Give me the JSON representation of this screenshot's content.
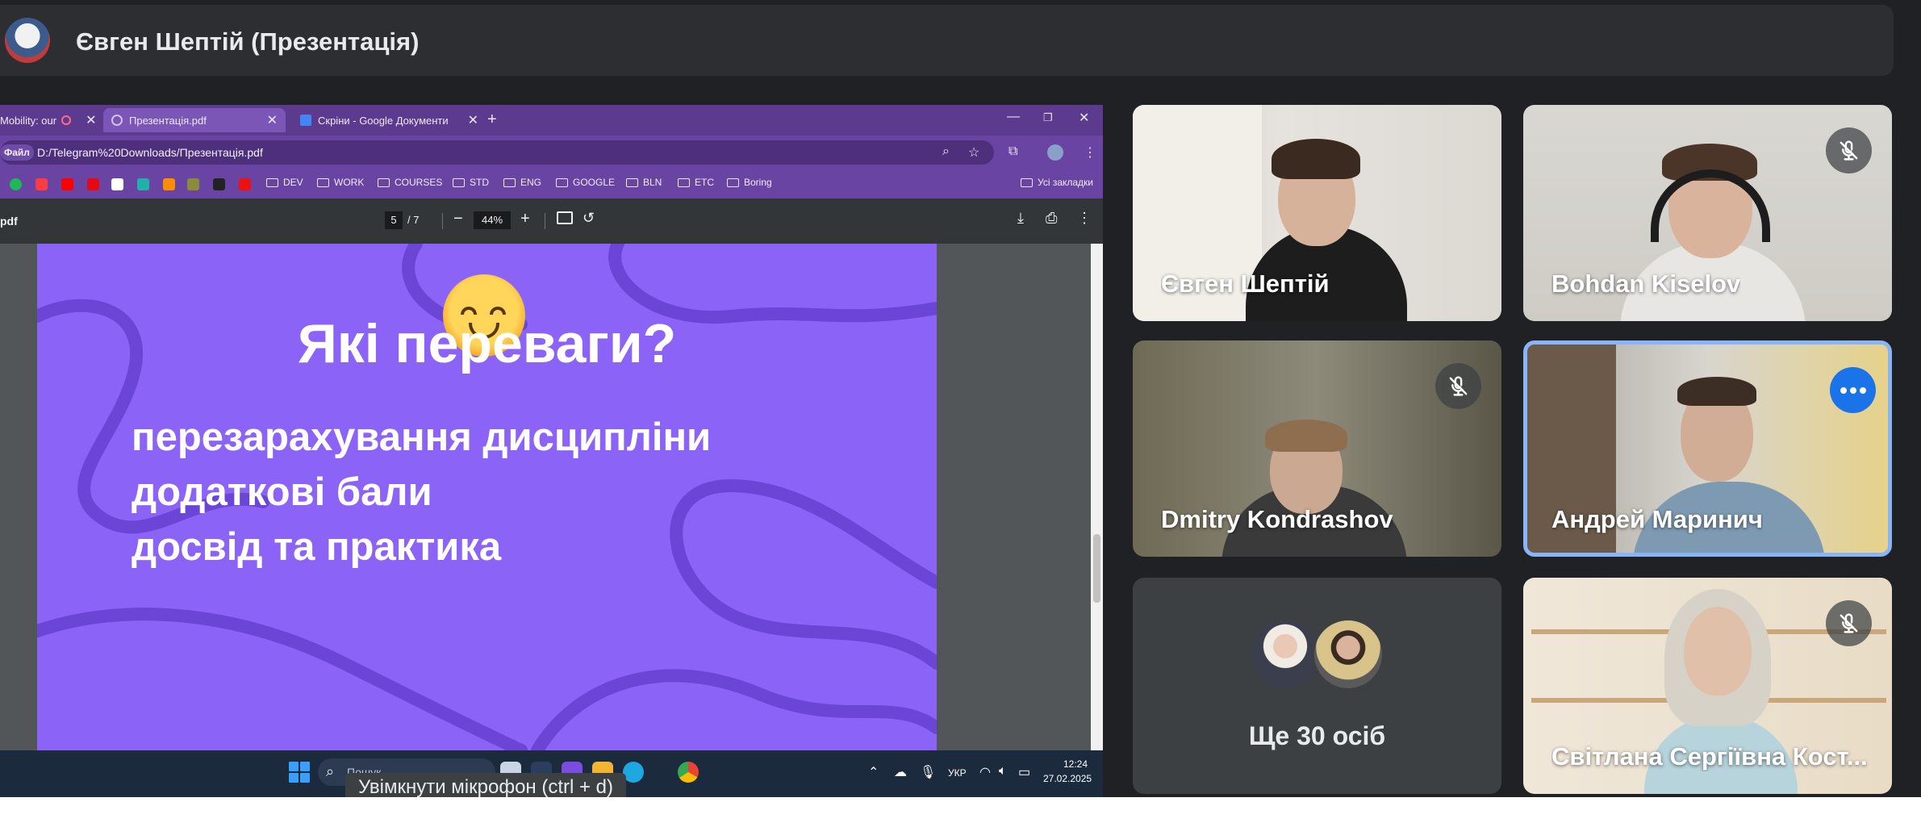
{
  "header": {
    "title": "Євген Шептій (Презентація)",
    "avatar_icon": "presenter-avatar"
  },
  "browser": {
    "tabs": [
      {
        "label": "Mobility: our",
        "icon": "recording-icon",
        "active": false
      },
      {
        "label": "Презентація.pdf",
        "icon": "globe-icon",
        "active": true
      },
      {
        "label": "Скріни - Google Документи",
        "icon": "google-docs-icon",
        "active": false
      }
    ],
    "address": {
      "chip": "Файл",
      "url": "D:/Telegram%20Downloads/Презентація.pdf"
    },
    "bookmark_folders": [
      "DEV",
      "WORK",
      "COURSES",
      "STD",
      "ENG",
      "GOOGLE",
      "BLN",
      "ETC",
      "Boring"
    ],
    "all_bookmarks": "Усі закладки",
    "accent": "#6a44a3"
  },
  "pdf_viewer": {
    "file_label": "pdf",
    "page_current": "5",
    "page_total": "/ 7",
    "zoom": "44%"
  },
  "slide": {
    "title": "Які переваги?",
    "lines": [
      "перезарахування дисципліни",
      "додаткові бали",
      "досвід та практика"
    ],
    "background": "#8b63f7"
  },
  "taskbar": {
    "search_placeholder": "Пошук",
    "language": "УКР",
    "time": "12:24",
    "date": "27.02.2025"
  },
  "tooltip": "Увімкнути мікрофон (ctrl + d)",
  "participants": [
    {
      "name": "Євген Шептій",
      "muted": false
    },
    {
      "name": "Bohdan Kiselov",
      "muted": true
    },
    {
      "name": "Dmitry Kondrashov",
      "muted": true
    },
    {
      "name": "Андрей Маринич",
      "muted": false,
      "speaking": true
    },
    {
      "name": "Світлана Сергіївна Кост...",
      "muted": true
    }
  ],
  "others": {
    "label": "Ще 30 осіб"
  },
  "colors": {
    "meet_bg": "#202124",
    "tile_bg": "#3c4043",
    "speaking_border": "#8ab4f8",
    "more_button": "#1a73e8"
  }
}
